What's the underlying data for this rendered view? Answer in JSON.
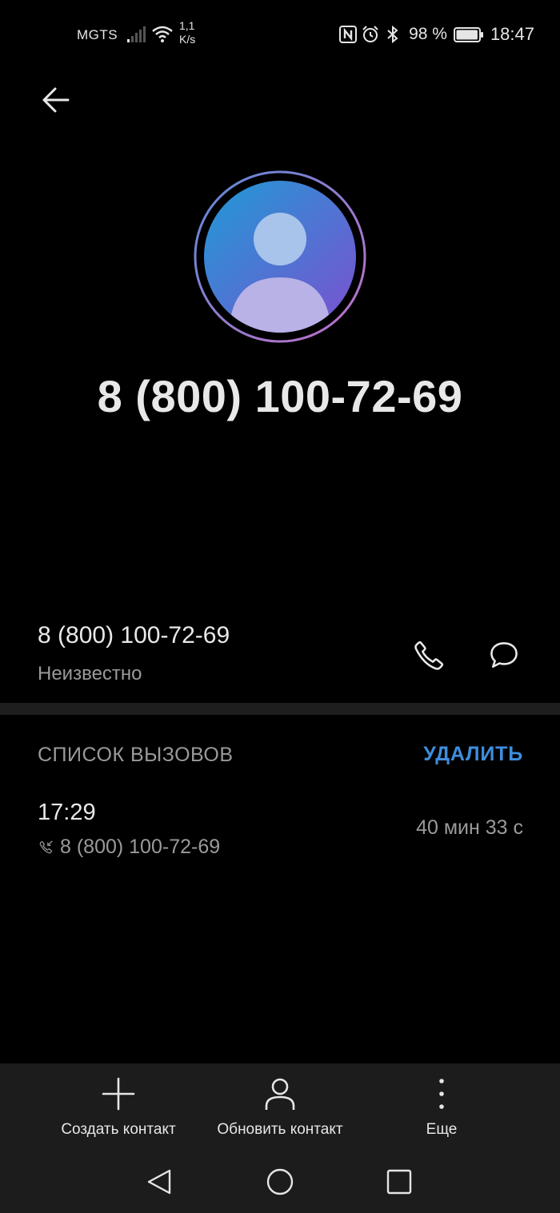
{
  "status_bar": {
    "carrier": "MGTS",
    "speed_value": "1,1",
    "speed_unit": "K/s",
    "battery_percent": "98 %",
    "battery_level": 0.98,
    "time": "18:47",
    "icons": [
      "signal-icon",
      "wifi-icon",
      "nfc-icon",
      "alarm-icon",
      "bluetooth-icon",
      "battery-icon"
    ]
  },
  "header": {
    "back_icon": "arrow-left-icon"
  },
  "contact": {
    "avatar_icon": "person-avatar-icon",
    "display_number": "8 (800) 100-72-69"
  },
  "number_row": {
    "number": "8 (800) 100-72-69",
    "label": "Неизвестно",
    "call_icon": "phone-icon",
    "message_icon": "message-bubble-icon"
  },
  "call_log": {
    "title": "СПИСОК ВЫЗОВОВ",
    "delete_label": "УДАЛИТЬ",
    "entries": [
      {
        "time": "17:29",
        "type_icon": "incoming-call-icon",
        "number": "8 (800) 100-72-69",
        "duration": "40 мин 33 с"
      }
    ]
  },
  "actions": {
    "create_contact": "Создать контакт",
    "update_contact": "Обновить контакт",
    "more": "Еще"
  },
  "colors": {
    "background": "#000000",
    "accent": "#3e8ede",
    "bottom_bar": "#1c1c1c",
    "secondary_text": "#9a9a9a"
  }
}
